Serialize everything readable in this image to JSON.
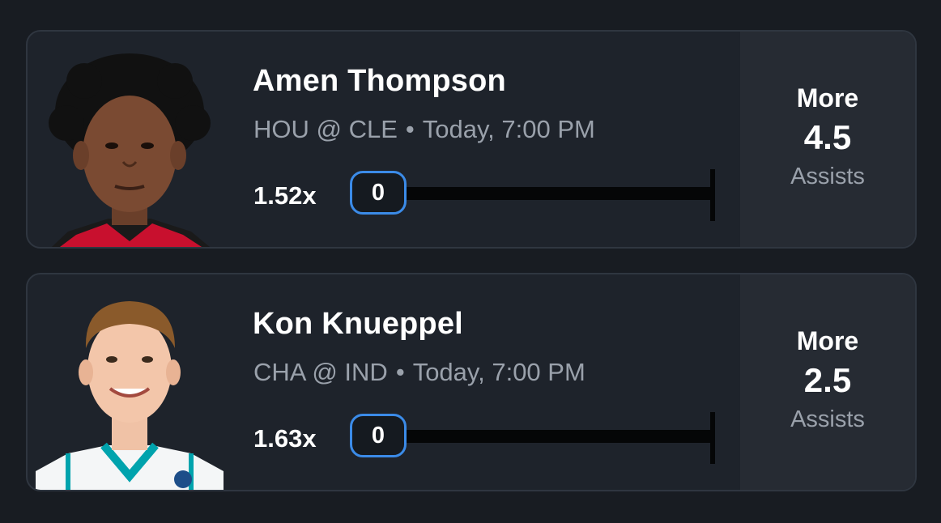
{
  "picks": [
    {
      "name": "Amen Thompson",
      "matchup": "HOU @ CLE",
      "time": "Today, 7:00 PM",
      "multiplier": "1.52x",
      "current_value": "0",
      "direction": "More",
      "line": "4.5",
      "stat": "Assists",
      "avatar": "player-headshot-rockets"
    },
    {
      "name": "Kon Knueppel",
      "matchup": "CHA @ IND",
      "time": "Today, 7:00 PM",
      "multiplier": "1.63x",
      "current_value": "0",
      "direction": "More",
      "line": "2.5",
      "stat": "Assists",
      "avatar": "player-headshot-hornets"
    }
  ],
  "separator": "•",
  "colors": {
    "background": "#181c22",
    "card": "#1e232b",
    "side_panel": "#262b33",
    "accent_blue": "#3b8be8",
    "muted_text": "#9aa1ab"
  }
}
